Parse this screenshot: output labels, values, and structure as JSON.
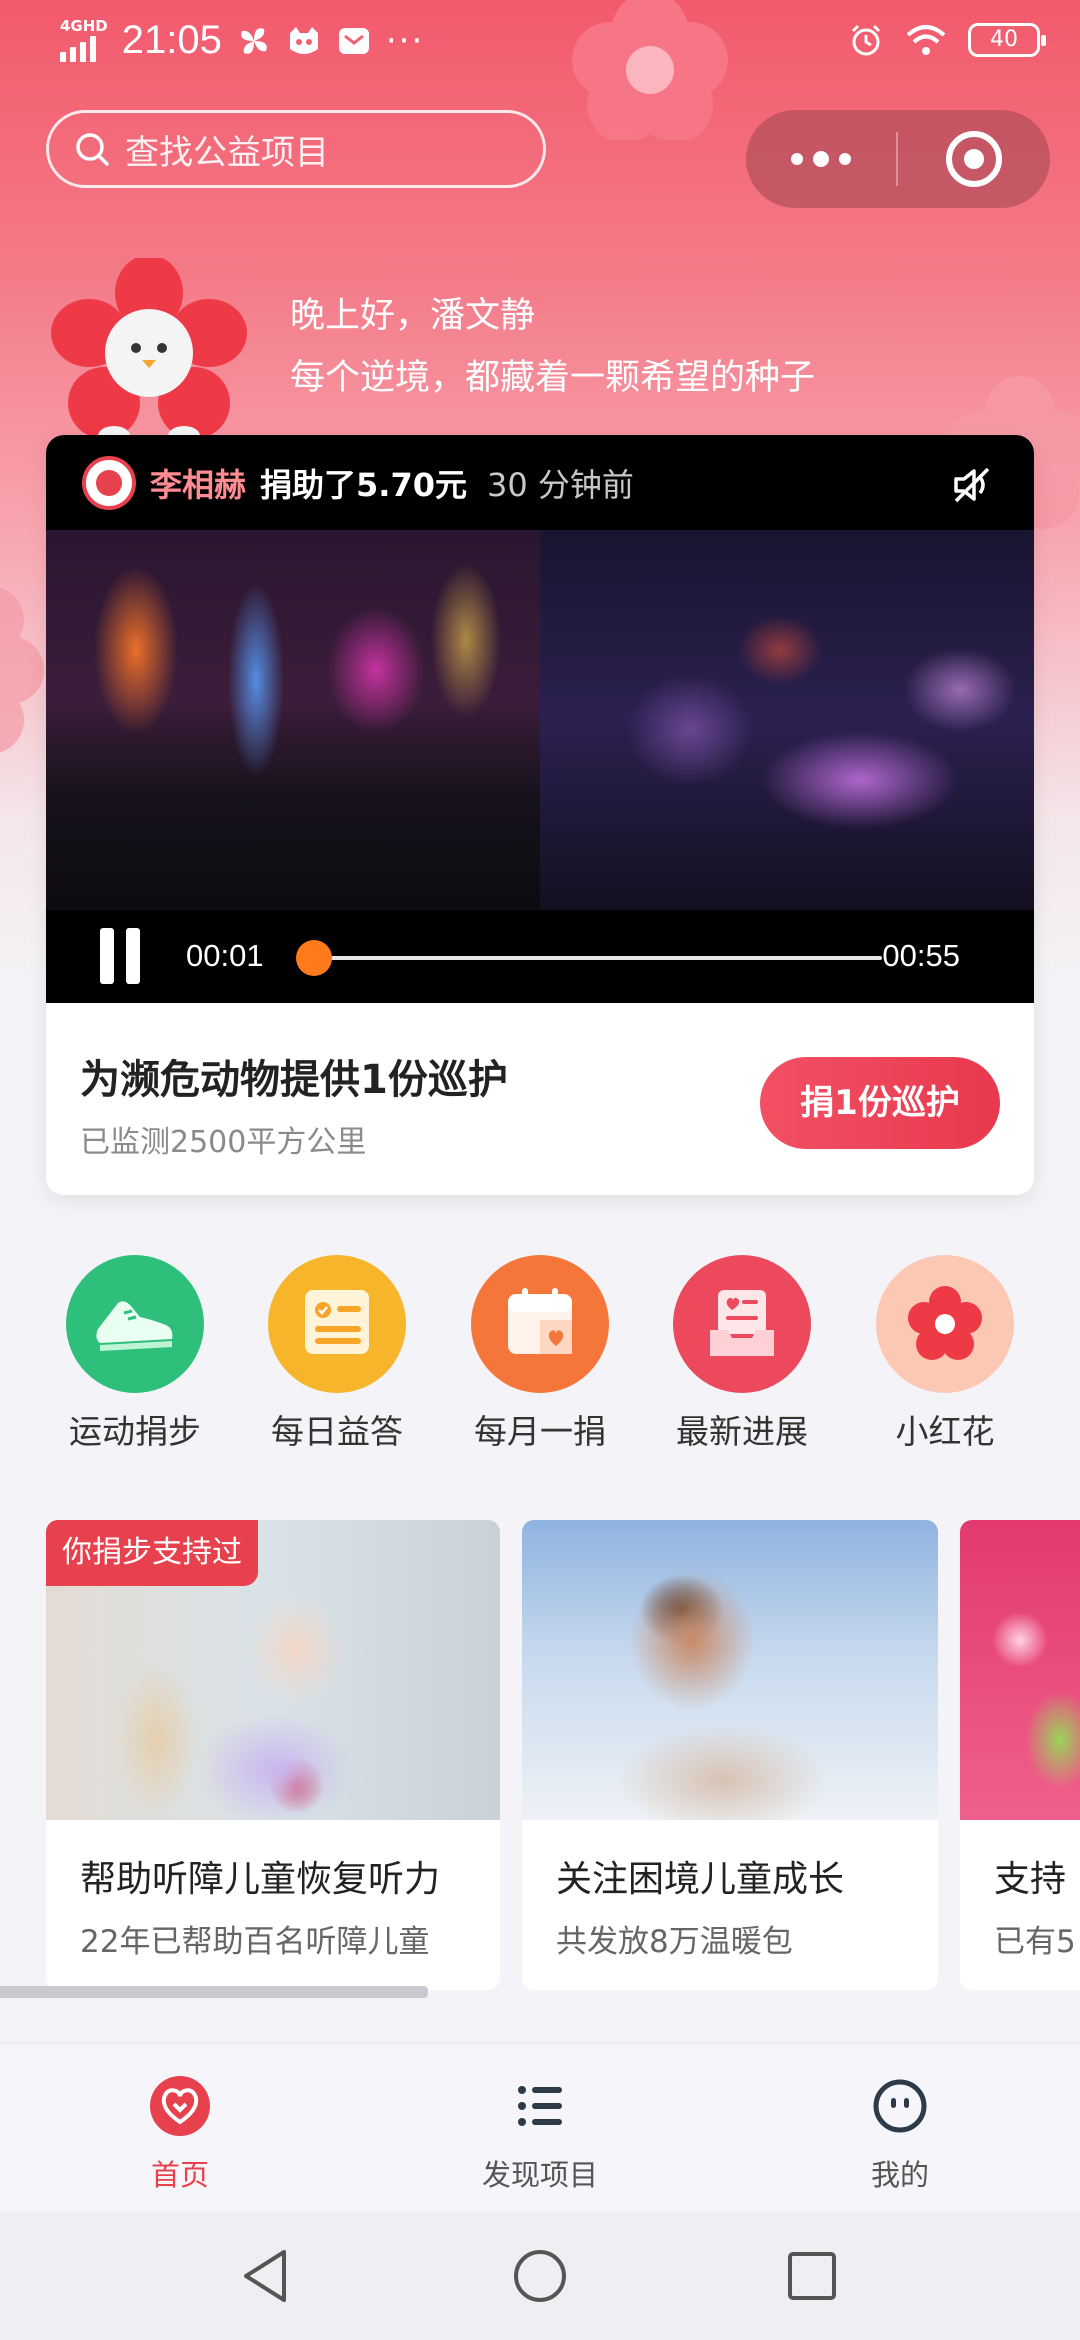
{
  "status_bar": {
    "network": "4GHD",
    "time": "21:05",
    "more": "···",
    "battery": "40"
  },
  "search": {
    "placeholder": "查找公益项目"
  },
  "greeting": {
    "line1": "晚上好，潘文静",
    "line2": "每个逆境，都藏着一颗希望的种子"
  },
  "video": {
    "donor_name": "李相赫",
    "donor_action": "捐助了5.70元",
    "donor_time": "30 分钟前",
    "time_current": "00:01",
    "time_total": "00:55",
    "progress": 0.0
  },
  "featured_project": {
    "title": "为濒危动物提供1份巡护",
    "subtitle": "已监测2500平方公里",
    "button": "捐1份巡护"
  },
  "quick_entries": [
    {
      "label": "运动捐步",
      "icon": "shoe-icon",
      "color": "#2ec07a"
    },
    {
      "label": "每日益答",
      "icon": "quiz-card-icon",
      "color": "#f7b52c"
    },
    {
      "label": "每月一捐",
      "icon": "calendar-heart-icon",
      "color": "#f5763a"
    },
    {
      "label": "最新进展",
      "icon": "inbox-heart-icon",
      "color": "#ec4a5c"
    },
    {
      "label": "小红花",
      "icon": "red-flower-icon",
      "color": "#fbc8b4"
    }
  ],
  "projects": [
    {
      "tag": "你捐步支持过",
      "title": "帮助听障儿童恢复听力",
      "subtitle": "22年已帮助百名听障儿童"
    },
    {
      "tag": "",
      "title": "关注困境儿童成长",
      "subtitle": "共发放8万温暖包"
    },
    {
      "tag": "",
      "title": "支持",
      "subtitle": "已有5"
    }
  ],
  "tabs": [
    {
      "label": "首页",
      "icon": "heart-home-icon",
      "active": true
    },
    {
      "label": "发现项目",
      "icon": "list-icon",
      "active": false
    },
    {
      "label": "我的",
      "icon": "smile-icon",
      "active": false
    }
  ],
  "colors": {
    "brand": "#e8414e",
    "progress": "#ff7a1a"
  }
}
